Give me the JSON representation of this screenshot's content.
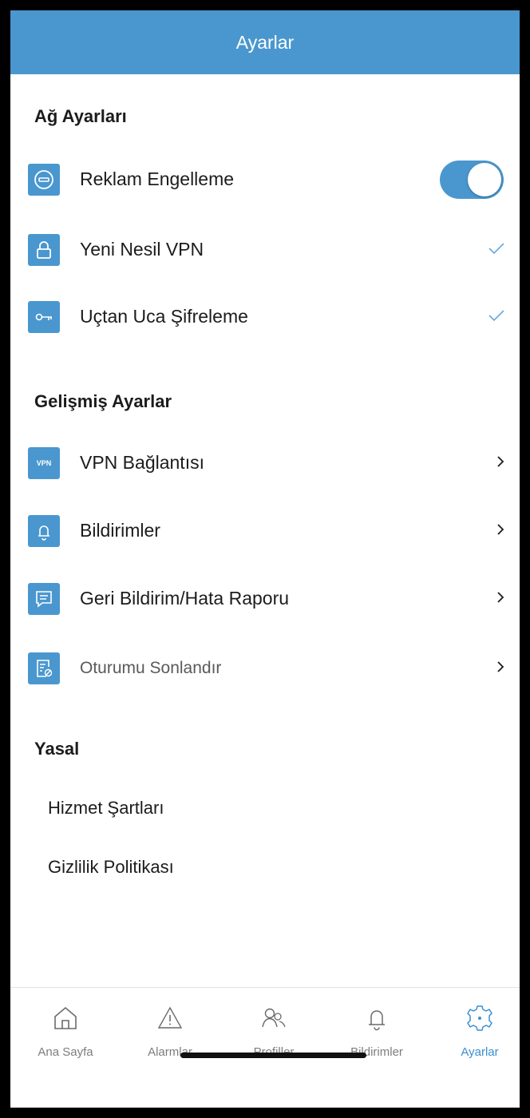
{
  "header": {
    "title": "Ayarlar"
  },
  "sections": {
    "network": {
      "title": "Ağ Ayarları",
      "items": [
        {
          "label": "Reklam Engelleme",
          "icon": "ad-block-icon",
          "control": "toggle",
          "on": true
        },
        {
          "label": "Yeni Nesil VPN",
          "icon": "lock-icon",
          "control": "check"
        },
        {
          "label": "Uçtan Uca Şifreleme",
          "icon": "key-icon",
          "control": "check"
        }
      ]
    },
    "advanced": {
      "title": "Gelişmiş Ayarlar",
      "items": [
        {
          "label": "VPN Bağlantısı",
          "icon": "vpn-icon",
          "icon_text": "VPN"
        },
        {
          "label": "Bildirimler",
          "icon": "bell-icon"
        },
        {
          "label": "Geri Bildirim/Hata Raporu",
          "icon": "feedback-icon"
        },
        {
          "label": "Oturumu Sonlandır",
          "icon": "logout-icon"
        }
      ]
    },
    "legal": {
      "title": "Yasal",
      "items": [
        {
          "label": "Hizmet Şartları"
        },
        {
          "label": "Gizlilik Politikası"
        }
      ]
    }
  },
  "tabbar": {
    "items": [
      {
        "label": "Ana Sayfa",
        "icon": "home-icon"
      },
      {
        "label": "Alarmlar",
        "icon": "alert-icon"
      },
      {
        "label": "Profiller",
        "icon": "profiles-icon"
      },
      {
        "label": "Bildirimler",
        "icon": "bell-icon"
      },
      {
        "label": "Ayarlar",
        "icon": "settings-icon",
        "active": true
      }
    ]
  },
  "colors": {
    "accent": "#4a97cf",
    "active_tab": "#3a8fd0"
  }
}
